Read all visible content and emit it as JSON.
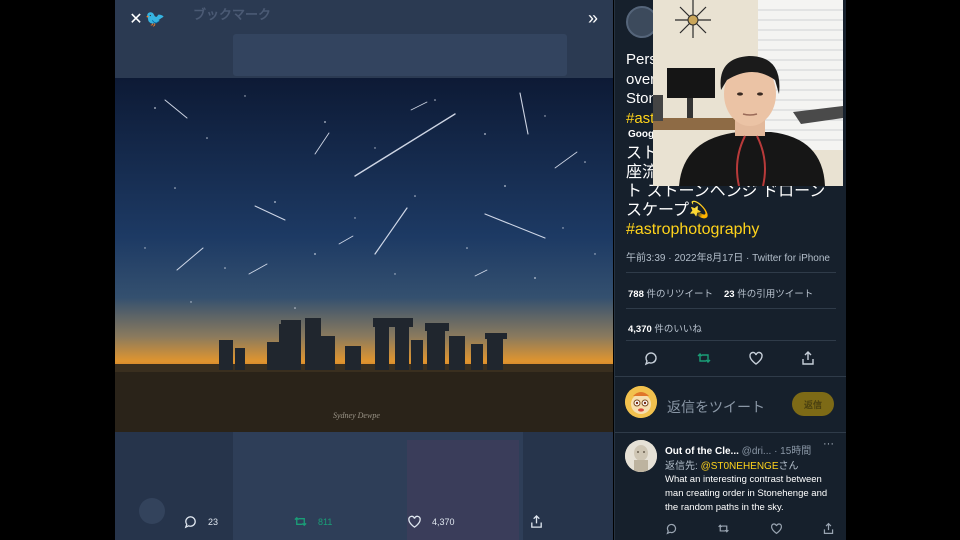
{
  "viewer": {
    "ghost_title": "ブックマーク",
    "close_icon": "close-icon",
    "expand_icon": "double-chevron-right-icon",
    "actions": [
      {
        "icon": "reply-icon",
        "count": "23"
      },
      {
        "icon": "retweet-icon",
        "count": "811"
      },
      {
        "icon": "like-icon",
        "count": "4,370"
      },
      {
        "icon": "share-icon",
        "count": ""
      }
    ],
    "photo_signature": "Sydney Dewpe"
  },
  "tweet": {
    "body_lines": [
      "Pers",
      "over",
      "Ston"
    ],
    "body_hashtag": "#ast",
    "translated_label": "Goog",
    "jp_lines": [
      "スト",
      "座流",
      "ト ストーンヘンジ ドローン",
      "スケープ💫"
    ],
    "jp_hashtag": "#astrophotography",
    "meta": "午前3:39 · 2022年8月17日 · Twitter for iPhone",
    "retweets_count": "788",
    "retweets_label": "件のリツイート",
    "quotes_count": "23",
    "quotes_label": "件の引用ツイート",
    "likes_count": "4,370",
    "likes_label": "件のいいね",
    "reply_placeholder": "返信をツイート",
    "reply_button": "返信"
  },
  "comment": {
    "name": "Out of the Cle...",
    "handle": "@dri...",
    "time": "· 15時間",
    "more": "···",
    "reply_to_prefix": "返信先: ",
    "reply_to_handle": "@ST0NEHENGE",
    "reply_to_suffix": "さん",
    "text": "What an interesting contrast between man creating order in Stonehenge and the random paths in the sky."
  },
  "colors": {
    "accent": "#ffd31b",
    "retweet_green": "#1a9e77",
    "pane_bg": "#16202c"
  }
}
